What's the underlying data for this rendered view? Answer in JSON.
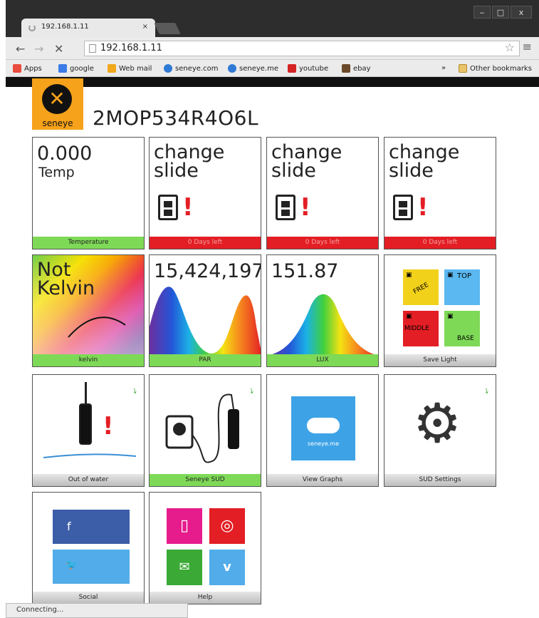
{
  "browser": {
    "tab_title": "192.168.1.11",
    "tab_close": "×",
    "url": "192.168.1.11",
    "win_buttons": [
      "‒",
      "□",
      "x"
    ],
    "bookmarks": [
      {
        "label": "Apps",
        "color": "#e94b3c"
      },
      {
        "label": "google",
        "color": "#3b7be8"
      },
      {
        "label": "Web mail",
        "color": "#f0a81c"
      },
      {
        "label": "seneye.com",
        "color": "#2f7ad6"
      },
      {
        "label": "seneye.me",
        "color": "#2f7ad6"
      },
      {
        "label": "youtube",
        "color": "#d62424"
      },
      {
        "label": "ebay",
        "color": "#6b4a2a"
      }
    ],
    "other_bookmarks": "Other bookmarks",
    "status": "Connecting..."
  },
  "page": {
    "logo_text": "seneye",
    "device_id": "2MOP534R4O6L"
  },
  "tiles": {
    "temperature": {
      "value": "0.000",
      "label": "Temp",
      "footer": "Temperature"
    },
    "slide1": {
      "line1": "change",
      "line2": "slide",
      "footer": "0 Days left"
    },
    "slide2": {
      "line1": "change",
      "line2": "slide",
      "footer": "0 Days left"
    },
    "slide3": {
      "line1": "change",
      "line2": "slide",
      "footer": "0 Days left"
    },
    "kelvin": {
      "line1": "Not",
      "line2": "Kelvin",
      "footer": "kelvin"
    },
    "par": {
      "value": "15,424,197.",
      "footer": "PAR"
    },
    "lux": {
      "value": "151.87",
      "footer": "LUX"
    },
    "save_light": {
      "free": "FREE",
      "top": "TOP",
      "middle": "MIDDLE",
      "base": "BASE",
      "footer": "Save Light"
    },
    "out_of_water": {
      "footer": "Out of water"
    },
    "seneye_sud": {
      "footer": "Seneye SUD"
    },
    "view_graphs": {
      "cloud_text": "seneye.me",
      "footer": "View Graphs"
    },
    "sud_settings": {
      "footer": "SUD Settings"
    },
    "social": {
      "facebook": "f",
      "twitter": "🐦",
      "footer": "Social"
    },
    "help": {
      "footer": "Help"
    }
  }
}
